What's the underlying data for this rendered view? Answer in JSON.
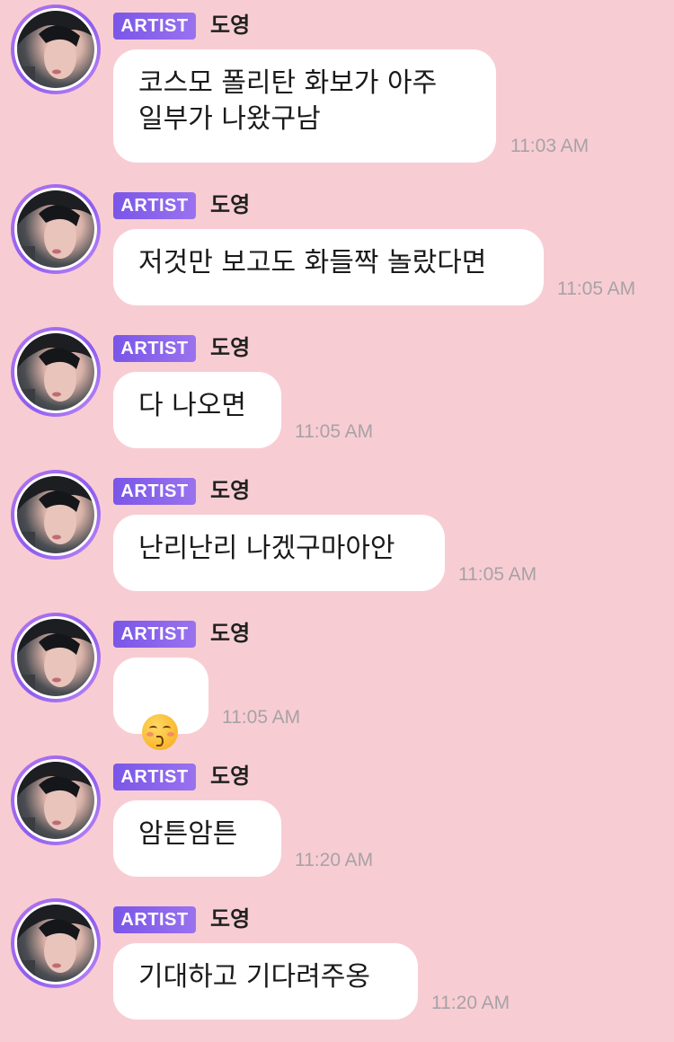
{
  "artist_badge": "ARTIST",
  "sender_name": "도영",
  "messages": [
    {
      "text": "코스모 폴리탄 화보가 아주\n일부가 나왔구남",
      "time": "11:03 AM"
    },
    {
      "text": "저것만 보고도 화들짝 놀랐다면",
      "time": "11:05 AM"
    },
    {
      "text": "다 나오면",
      "time": "11:05 AM"
    },
    {
      "text": "난리난리 나겠구마아안",
      "time": "11:05 AM"
    },
    {
      "emoji": "kissing-face-with-closed-eyes",
      "time": "11:05 AM"
    },
    {
      "text": "암튼암튼",
      "time": "11:20 AM"
    },
    {
      "text": "기대하고 기다려주옹",
      "time": "11:20 AM"
    }
  ],
  "colors": {
    "background": "#f7cdd3",
    "bubble": "#ffffff",
    "badge": "#8a64ec",
    "time": "#a7a2a6"
  }
}
